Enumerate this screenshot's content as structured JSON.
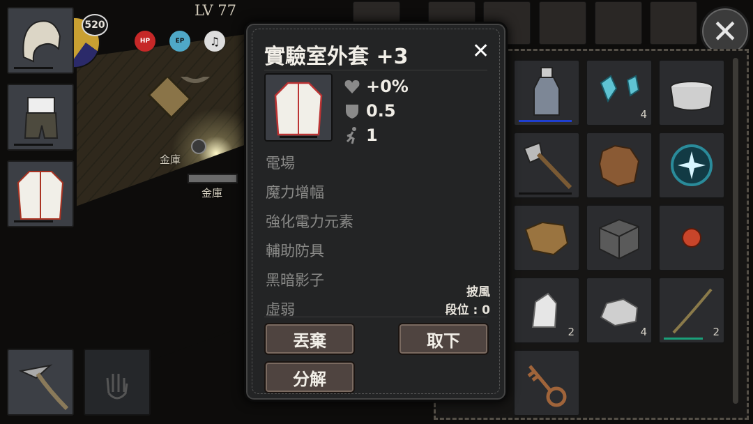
{
  "hud": {
    "level_text": "LV 77",
    "ring_value": "520",
    "stats": [
      {
        "label": "HP",
        "color": "#c62828"
      },
      {
        "label": "EP",
        "color": "#4fa8c7"
      }
    ]
  },
  "world": {
    "labels": [
      "金庫",
      "金庫"
    ]
  },
  "popup": {
    "title": "實驗室外套 +3",
    "close_icon": "close-icon",
    "stats": [
      {
        "icon": "heart-icon",
        "value": "+0%"
      },
      {
        "icon": "shield-icon",
        "value": "0.5"
      },
      {
        "icon": "running-figure-icon",
        "value": "1"
      }
    ],
    "effects": [
      "電場",
      "魔力增幅",
      "強化電力元素",
      "輔助防具",
      "黑暗影子",
      "虛弱"
    ],
    "slot_type": "披風",
    "tier": "段位 : 0",
    "buttons": {
      "discard": "丟棄",
      "unequip": "取下",
      "disassemble": "分解"
    }
  },
  "inventory": {
    "items": [
      {
        "name": "glass-bottle",
        "qty": "",
        "durability_color": "#1f3fd0"
      },
      {
        "name": "blue-crystals",
        "qty": "4",
        "durability_color": ""
      },
      {
        "name": "cooking-pot",
        "qty": "",
        "durability_color": ""
      },
      {
        "name": "axe",
        "qty": "",
        "durability_color": "#111111"
      },
      {
        "name": "animal-pelt",
        "qty": "",
        "durability_color": ""
      },
      {
        "name": "magic-orb",
        "qty": "",
        "durability_color": ""
      },
      {
        "name": "leather-scrap",
        "qty": "",
        "durability_color": ""
      },
      {
        "name": "stone-block",
        "qty": "",
        "durability_color": ""
      },
      {
        "name": "red-gem",
        "qty": "",
        "durability_color": ""
      },
      {
        "name": "white-ore",
        "qty": "2",
        "durability_color": ""
      },
      {
        "name": "rock",
        "qty": "4",
        "durability_color": ""
      },
      {
        "name": "wooden-stick",
        "qty": "2",
        "durability_color": "#1aa07a"
      },
      {
        "name": "key",
        "qty": "",
        "durability_color": ""
      }
    ]
  }
}
